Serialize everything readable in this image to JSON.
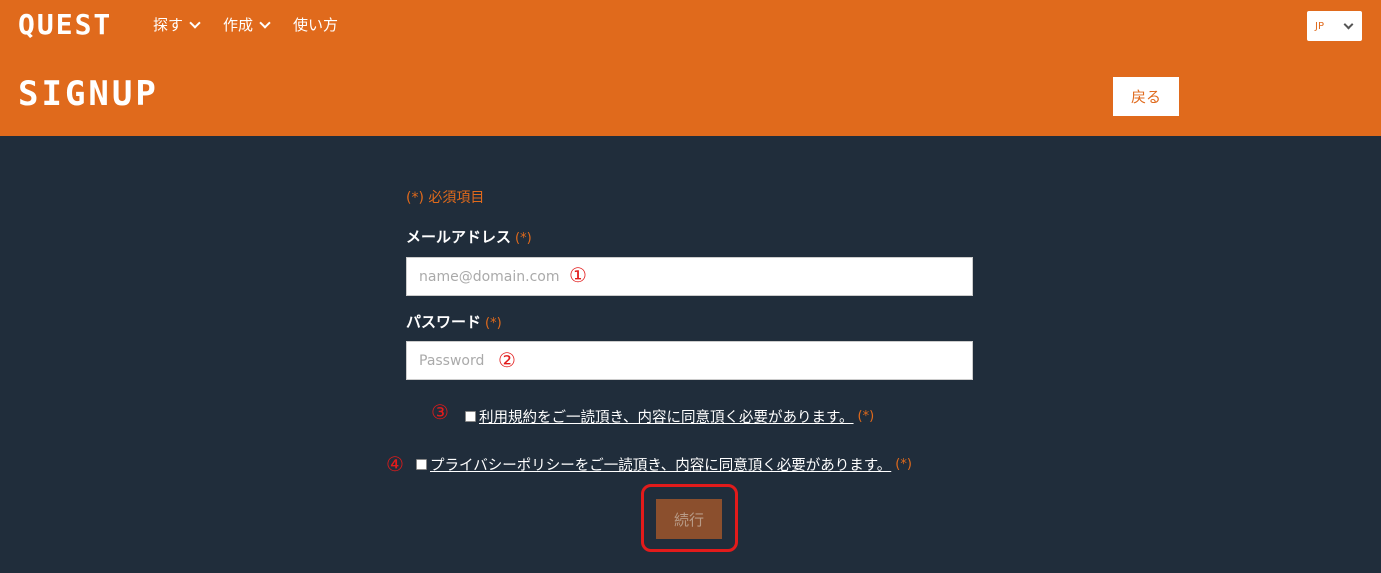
{
  "header": {
    "logo": "QUEST",
    "nav": [
      "探す",
      "作成",
      "使い方"
    ],
    "lang": "JP",
    "title": "SIGNUP",
    "back_label": "戻る"
  },
  "form": {
    "required_note": "(*) 必須項目",
    "required_mark": "(*)",
    "email_label": "メールアドレス",
    "email_placeholder": "name@domain.com",
    "password_label": "パスワード",
    "password_placeholder": "Password",
    "terms_text": "利用規約をご一読頂き、内容に同意頂く必要があります。",
    "privacy_text": "プライバシーポリシーをご一読頂き、内容に同意頂く必要があります。",
    "submit_label": "続行"
  },
  "annotations": {
    "marker1": "①",
    "marker2": "②",
    "marker3": "③",
    "marker4": "④"
  },
  "colors": {
    "brand": "#e06a1c",
    "background": "#202d3b",
    "annotation": "#e21b1b",
    "submit_bg": "#8b4f2d"
  }
}
